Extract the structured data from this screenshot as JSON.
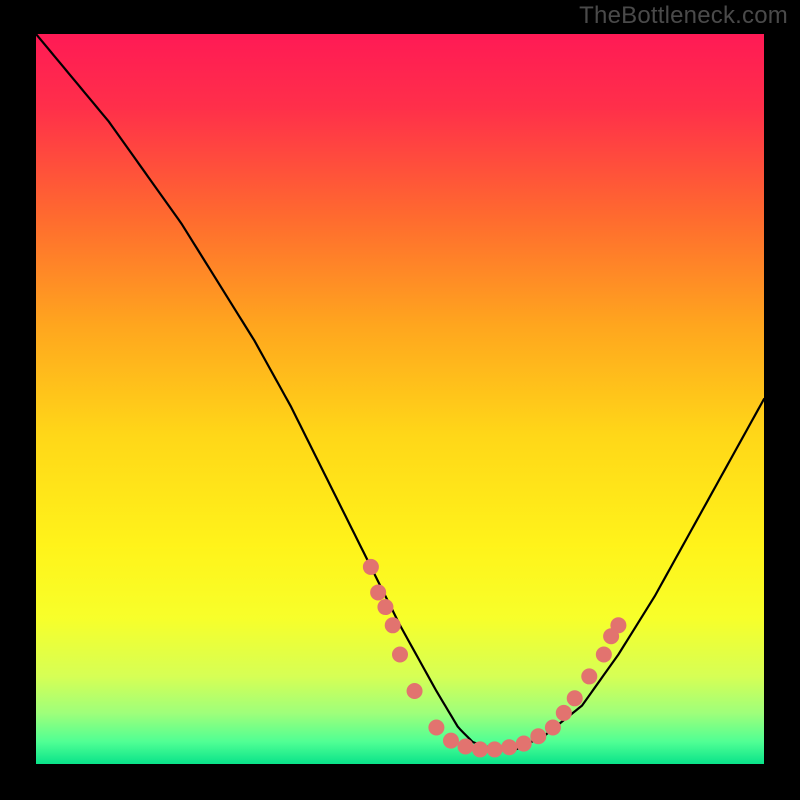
{
  "watermark": "TheBottleneck.com",
  "gradient": {
    "stops": [
      {
        "offset": 0.0,
        "color": "#ff1a55"
      },
      {
        "offset": 0.1,
        "color": "#ff2f4a"
      },
      {
        "offset": 0.25,
        "color": "#ff6a2f"
      },
      {
        "offset": 0.4,
        "color": "#ffa61e"
      },
      {
        "offset": 0.55,
        "color": "#ffd718"
      },
      {
        "offset": 0.7,
        "color": "#fff31a"
      },
      {
        "offset": 0.8,
        "color": "#f7ff2a"
      },
      {
        "offset": 0.88,
        "color": "#d6ff55"
      },
      {
        "offset": 0.93,
        "color": "#9fff7a"
      },
      {
        "offset": 0.97,
        "color": "#4fff94"
      },
      {
        "offset": 1.0,
        "color": "#09e38a"
      }
    ]
  },
  "chart_data": {
    "type": "line",
    "title": "",
    "xlabel": "",
    "ylabel": "",
    "xlim": [
      0,
      100
    ],
    "ylim": [
      0,
      100
    ],
    "series": [
      {
        "name": "bottleneck-curve",
        "x": [
          0,
          5,
          10,
          15,
          20,
          25,
          30,
          35,
          40,
          45,
          50,
          55,
          58,
          60,
          63,
          66,
          70,
          75,
          80,
          85,
          90,
          95,
          100
        ],
        "y": [
          100,
          94,
          88,
          81,
          74,
          66,
          58,
          49,
          39,
          29,
          19,
          10,
          5,
          3,
          2,
          2,
          4,
          8,
          15,
          23,
          32,
          41,
          50
        ]
      }
    ],
    "marker_cluster": {
      "name": "highlight-points",
      "color": "#e2736f",
      "radius_frac": 0.011,
      "points": [
        {
          "x": 46,
          "y": 27
        },
        {
          "x": 47,
          "y": 23.5
        },
        {
          "x": 48,
          "y": 21.5
        },
        {
          "x": 49,
          "y": 19
        },
        {
          "x": 50,
          "y": 15
        },
        {
          "x": 52,
          "y": 10
        },
        {
          "x": 55,
          "y": 5
        },
        {
          "x": 57,
          "y": 3.2
        },
        {
          "x": 59,
          "y": 2.4
        },
        {
          "x": 61,
          "y": 2.0
        },
        {
          "x": 63,
          "y": 2.0
        },
        {
          "x": 65,
          "y": 2.3
        },
        {
          "x": 67,
          "y": 2.8
        },
        {
          "x": 69,
          "y": 3.8
        },
        {
          "x": 71,
          "y": 5
        },
        {
          "x": 72.5,
          "y": 7
        },
        {
          "x": 74,
          "y": 9
        },
        {
          "x": 76,
          "y": 12
        },
        {
          "x": 78,
          "y": 15
        },
        {
          "x": 79,
          "y": 17.5
        },
        {
          "x": 80,
          "y": 19
        }
      ]
    }
  }
}
